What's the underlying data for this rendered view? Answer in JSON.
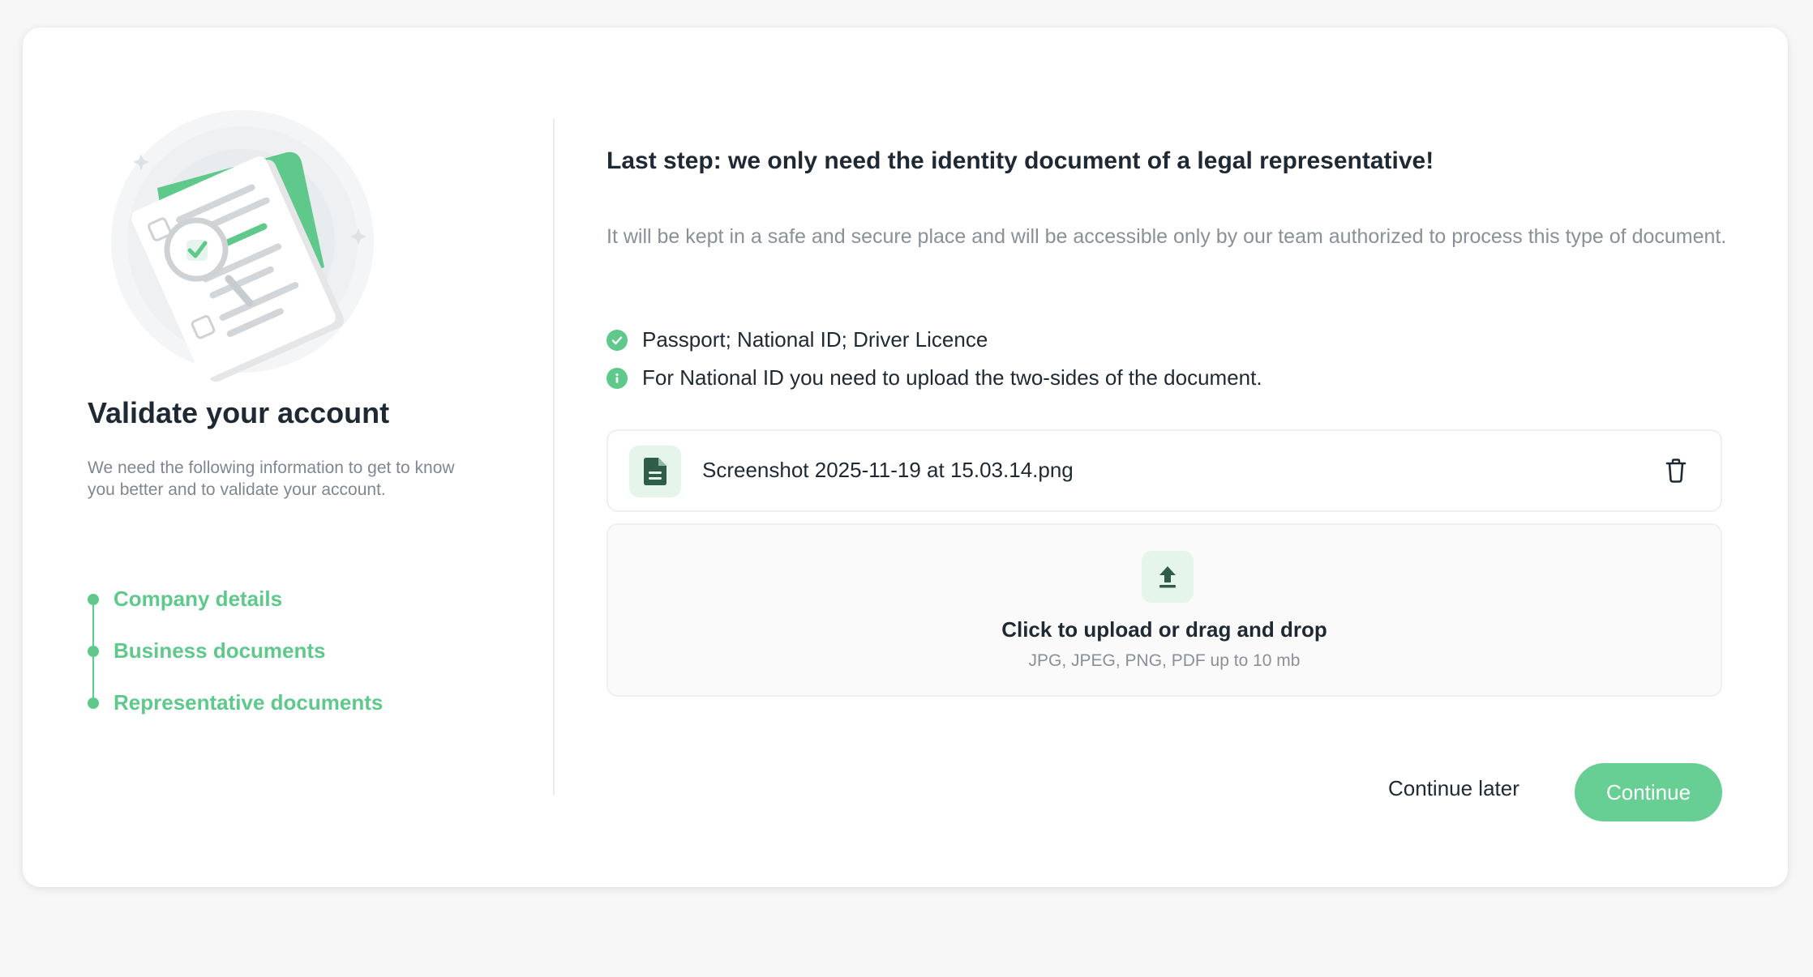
{
  "sidebar": {
    "title": "Validate your account",
    "description": "We need the following information to get to know you better and to validate your account.",
    "steps": [
      {
        "label": "Company details"
      },
      {
        "label": "Business documents"
      },
      {
        "label": "Representative documents"
      }
    ]
  },
  "main": {
    "heading": "Last step: we only need the identity document of a legal representative!",
    "note": "It will be kept in a safe and secure place and will be accessible only by our team authorized to process this type of document.",
    "requirements": [
      {
        "icon": "check-circle-icon",
        "text": "Passport; National ID; Driver Licence"
      },
      {
        "icon": "info-circle-icon",
        "text": "For National ID you need to upload the two-sides of the document."
      }
    ],
    "uploaded_file": {
      "name": "Screenshot 2025-11-19 at 15.03.14.png",
      "icon": "file-document-icon",
      "delete_icon": "trash-icon"
    },
    "dropzone": {
      "icon": "upload-icon",
      "title": "Click to upload or drag and drop",
      "subtitle": "JPG, JPEG, PNG, PDF up to 10 mb"
    },
    "actions": {
      "continue_later": "Continue later",
      "continue": "Continue"
    }
  },
  "colors": {
    "accent": "#5fc98c",
    "button": "#68cf94",
    "text": "#1f2933",
    "muted": "#8a9097",
    "background": "#f6f7f6"
  }
}
